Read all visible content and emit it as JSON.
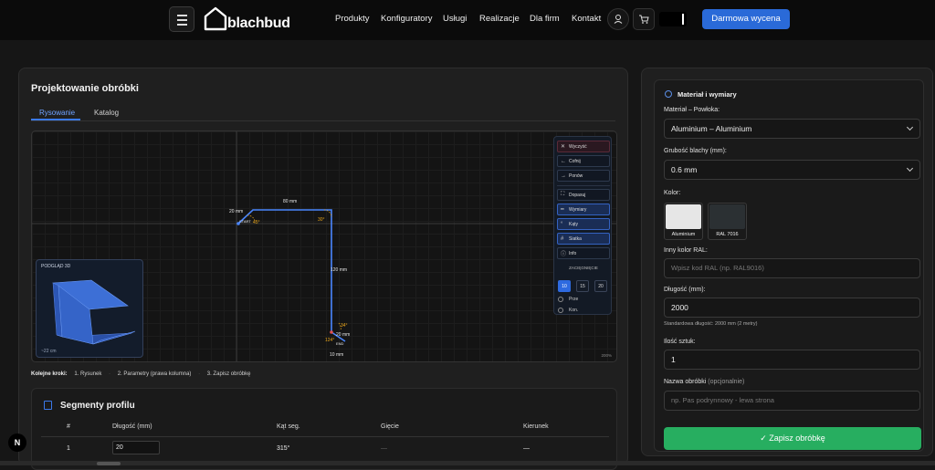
{
  "nav": {
    "logo": "blachbud",
    "links": [
      "Produkty",
      "Konfiguratory",
      "Usługi",
      "Realizacje",
      "Dla firm",
      "Kontakt"
    ],
    "cta": "Darmowa wycena"
  },
  "designer": {
    "title": "Projektowanie obróbki",
    "tabs": [
      "Rysowanie",
      "Katalog"
    ],
    "tools": {
      "clear": "Wyczyść",
      "undo": "Cofnij",
      "redo": "Ponów",
      "fit": "Dopasuj",
      "dimensions": "Wymiary",
      "angles": "Kąty",
      "grid": "Siatka",
      "info": "Info"
    },
    "snap_label": "ZACIĘGNIĘCIE",
    "snap_options": [
      "10",
      "15",
      "20"
    ],
    "snap_selected": "10",
    "radios": [
      "Prze",
      "Kon."
    ],
    "preview_label": "PODGLĄD 3D",
    "preview_caption": "~22 cm",
    "zoom": "200%",
    "drawing_labels": {
      "top_seg": "80 mm",
      "left_seg": "20 mm",
      "start": "START",
      "angle_left": "45°",
      "angle_right": "30°",
      "vertical": "120 mm",
      "angle_bottom_top": "34°",
      "bottom_small": "20 mm",
      "angle_bottom": "124°",
      "end": "END",
      "bottom_seg": "10 mm"
    }
  },
  "steps": {
    "label": "Kolejne kroki:",
    "items": [
      "1. Rysunek",
      "2. Parametry (prawa kolumna)",
      "3. Zapisz obróbkę"
    ]
  },
  "segments": {
    "title": "Segmenty profilu",
    "headers": [
      "#",
      "Długość (mm)",
      "Kąt seg.",
      "Gięcie",
      "Kierunek"
    ],
    "rows": [
      {
        "num": "1",
        "length": "20",
        "angle": "315°",
        "bend": "—",
        "direction": "—"
      }
    ]
  },
  "form": {
    "title": "Materiał i wymiary",
    "material_label": "Materiał – Powłoka:",
    "material_value": "Aluminium – Aluminium",
    "thickness_label": "Grubość blachy (mm):",
    "thickness_value": "0.6 mm",
    "color_label": "Kolor:",
    "colors": [
      {
        "name": "Aluminium",
        "hex": "#e6e6e6"
      },
      {
        "name": "RAL 7016",
        "hex": "#2b3033"
      }
    ],
    "ral_label": "Inny kolor RAL:",
    "ral_placeholder": "Wpisz kod RAL (np. RAL9016)",
    "length_label": "Długość (mm):",
    "length_value": "2000",
    "length_hint": "Standardowa długość: 2000 mm (2 metry)",
    "qty_label": "Ilość sztuk:",
    "qty_value": "1",
    "name_label": "Nazwa obróbki",
    "name_optional": "(opcjonalnie)",
    "name_placeholder": "np. Pas podrynnowy - lewa strona",
    "save": "Zapisz obróbkę"
  },
  "badge": "N",
  "colors": {
    "accent": "#2a6ad8",
    "save": "#27ae60",
    "angle": "#e8a51a",
    "line": "#4a86ff"
  }
}
